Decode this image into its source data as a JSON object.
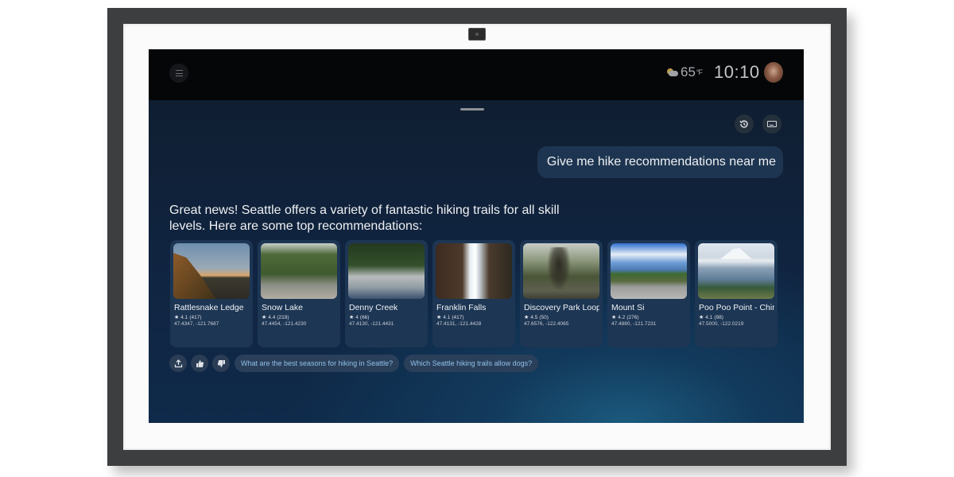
{
  "device": {
    "camera_label": "camera"
  },
  "status_bar": {
    "weather_icon": "partly-cloudy-icon",
    "temperature": "65",
    "temperature_unit": "°F",
    "time": "10:10"
  },
  "toolbar": {
    "menu_icon": "menu-icon",
    "history_icon": "history-icon",
    "keyboard_icon": "keyboard-icon"
  },
  "conversation": {
    "user_message": "Give me hike recommendations near me",
    "assistant_message": "Great news! Seattle offers a variety of fantastic hiking trails for all skill levels. Here are some top recommendations:"
  },
  "trails": [
    {
      "name": "Rattlesnake Ledge",
      "rating": "4.1",
      "reviews": "(417)",
      "coords": "47.4347, -121.7687"
    },
    {
      "name": "Snow Lake",
      "rating": "4.4",
      "reviews": "(219)",
      "coords": "47.4454, -121.4230"
    },
    {
      "name": "Denny Creek",
      "rating": "4",
      "reviews": "(66)",
      "coords": "47.4130, -121.4431"
    },
    {
      "name": "Franklin Falls",
      "rating": "4.1",
      "reviews": "(417)",
      "coords": "47.4131, -121.4428"
    },
    {
      "name": "Discovery Park Loop",
      "rating": "4.5",
      "reviews": "(50)",
      "coords": "47.6576, -122.4065"
    },
    {
      "name": "Mount Si",
      "rating": "4.2",
      "reviews": "(276)",
      "coords": "47.4880, -121.7231"
    },
    {
      "name": "Poo Poo Point - Chirico Trail",
      "rating": "4.1",
      "reviews": "(98)",
      "coords": "47.5000, -122.0219"
    }
  ],
  "actions": {
    "share_icon": "share-icon",
    "thumbs_up_icon": "thumbs-up-icon",
    "thumbs_down_icon": "thumbs-down-icon",
    "suggestions": [
      "What are the best seasons for hiking in Seattle?",
      "Which Seattle hiking trails allow dogs?"
    ]
  },
  "colors": {
    "frame": "#3d3e40",
    "mat": "#fbfbfb",
    "topbar": "#050608",
    "user_bubble": "#1d3550",
    "card": "#1d3654",
    "chip_text": "#8fc0e8"
  }
}
